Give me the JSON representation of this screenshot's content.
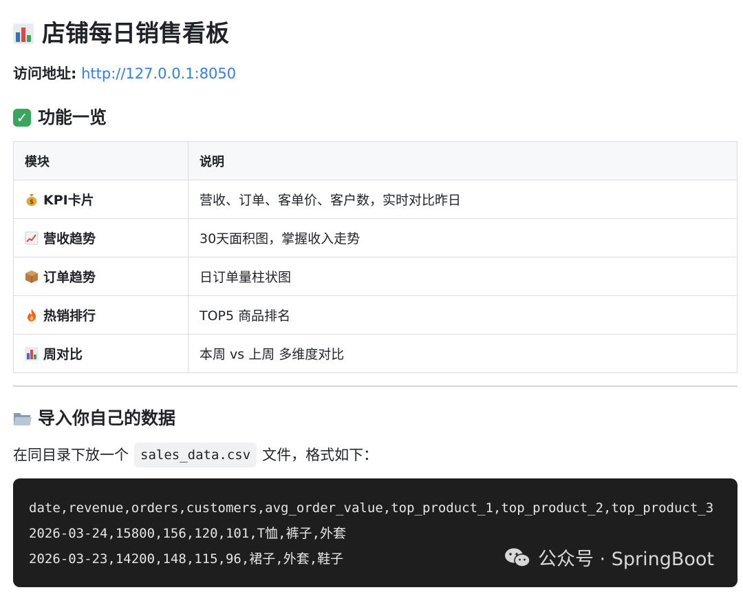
{
  "page": {
    "title": "店铺每日销售看板",
    "address_label": "访问地址:",
    "address_url": "http://127.0.0.1:8050",
    "features_heading": "功能一览",
    "import_heading": "导入你自己的数据",
    "intro_before": "在同目录下放一个",
    "intro_code": "sales_data.csv",
    "intro_after": "文件，格式如下："
  },
  "table": {
    "headers": [
      "模块",
      "说明"
    ],
    "rows": [
      {
        "icon": "money-bag-icon",
        "module": "KPI卡片",
        "desc": "营收、订单、客单价、客户数，实时对比昨日"
      },
      {
        "icon": "trend-up-icon",
        "module": "营收趋势",
        "desc": "30天面积图，掌握收入走势"
      },
      {
        "icon": "package-icon",
        "module": "订单趋势",
        "desc": "日订单量柱状图"
      },
      {
        "icon": "fire-icon",
        "module": "热销排行",
        "desc": "TOP5 商品排名"
      },
      {
        "icon": "bar-chart-icon",
        "module": "周对比",
        "desc": "本周 vs 上周 多维度对比"
      }
    ]
  },
  "code": {
    "lines": [
      "date,revenue,orders,customers,avg_order_value,top_product_1,top_product_2,top_product_3",
      "2026-03-24,15800,156,120,101,T恤,裤子,外套",
      "2026-03-23,14200,148,115,96,裙子,外套,鞋子"
    ]
  },
  "watermark": {
    "text": "公众号 · SpringBoot"
  },
  "colors": {
    "link": "#2f7fe6",
    "code_bg": "#1e1e1e",
    "table_border": "#d8dee4",
    "header_bg": "#f6f8fa",
    "check_green": "#3ba55d"
  }
}
